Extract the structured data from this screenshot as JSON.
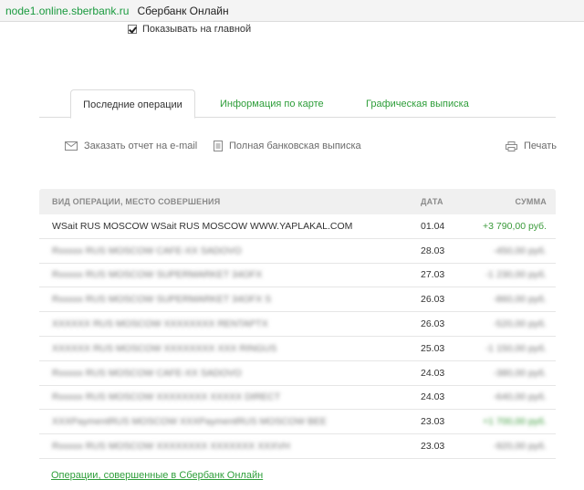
{
  "window": {
    "url": "node1.online.sberbank.ru",
    "site_title": "Сбербанк Онлайн"
  },
  "show_on_main": {
    "label": "Показывать на главной",
    "checked": true
  },
  "tabs": [
    {
      "label": "Последние операции",
      "active": true
    },
    {
      "label": "Информация по карте",
      "active": false
    },
    {
      "label": "Графическая выписка",
      "active": false
    }
  ],
  "actions": {
    "email_report": "Заказать отчет на e-mail",
    "full_statement": "Полная банковская выписка",
    "print": "Печать"
  },
  "table": {
    "headers": [
      "ВИД ОПЕРАЦИИ, МЕСТО СОВЕРШЕНИЯ",
      "ДАТА",
      "СУММА"
    ],
    "rows": [
      {
        "description": "WSait RUS MOSCOW WSait RUS MOSCOW WWW.YAPLAKAL.COM",
        "date": "01.04",
        "amount": "+3 790,00 руб.",
        "obscured": false
      },
      {
        "description": "Rxxxxx RUS MOSCOW CAFE-XX SADOVO",
        "date": "28.03",
        "amount": "-450,00 руб.",
        "obscured": true
      },
      {
        "description": "Rxxxxx RUS MOSCOW SUPERMARKET 34OFX",
        "date": "27.03",
        "amount": "-1 230,00 руб.",
        "obscured": true
      },
      {
        "description": "Rxxxxx RUS MOSCOW SUPERMARKET 34OFX S",
        "date": "26.03",
        "amount": "-860,00 руб.",
        "obscured": true
      },
      {
        "description": "XXXXXX RUS MOSCOW XXXXXXXX RENTAPTX",
        "date": "26.03",
        "amount": "-520,00 руб.",
        "obscured": true
      },
      {
        "description": "XXXXXX RUS MOSCOW XXXXXXXX XXX RINGUS",
        "date": "25.03",
        "amount": "-1 150,00 руб.",
        "obscured": true
      },
      {
        "description": "Rxxxxx RUS MOSCOW CAFE-XX SADOVO",
        "date": "24.03",
        "amount": "-380,00 руб.",
        "obscured": true
      },
      {
        "description": "Rxxxxx RUS MOSCOW XXXXXXXX XXXXX DIRECT",
        "date": "24.03",
        "amount": "-640,00 руб.",
        "obscured": true
      },
      {
        "description": "XXXPaymentRUS MOSCOW XXXPaymentRUS MOSCOW BEE",
        "date": "23.03",
        "amount": "+1 700,00 руб.",
        "obscured": true
      },
      {
        "description": "Rxxxxx RUS MOSCOW XXXXXXXX XXXXXXX XXXVH",
        "date": "23.03",
        "amount": "-920,00 руб.",
        "obscured": true
      }
    ]
  },
  "footer_link": "Операции, совершенные в Сбербанк Онлайн",
  "colors": {
    "accent_green": "#2e9e3a",
    "header_bg": "#f0f0f0"
  }
}
